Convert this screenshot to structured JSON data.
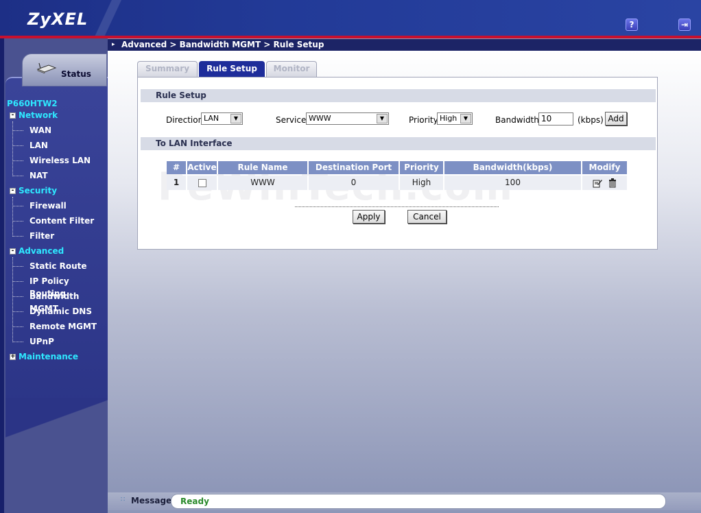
{
  "header": {
    "brand": "ZyXEL",
    "help_icon": "question-icon",
    "logout_icon": "logout-icon",
    "accent_red": "#c8102e",
    "brand_blue": "#1d2f86"
  },
  "breadcrumb": "Advanced > Bandwidth MGMT > Rule Setup",
  "sidebar": {
    "status_tab": "Status",
    "device_name": "P660HTW2",
    "sections": [
      {
        "label": "Network",
        "expanded": true,
        "items": [
          "WAN",
          "LAN",
          "Wireless LAN",
          "NAT"
        ]
      },
      {
        "label": "Security",
        "expanded": true,
        "items": [
          "Firewall",
          "Content Filter",
          "Filter"
        ]
      },
      {
        "label": "Advanced",
        "expanded": true,
        "items": [
          "Static Route",
          "IP Policy Routing",
          "Bandwidth MGMT",
          "Dynamic DNS",
          "Remote MGMT",
          "UPnP"
        ]
      },
      {
        "label": "Maintenance",
        "expanded": false,
        "items": []
      }
    ]
  },
  "tabs": {
    "summary": "Summary",
    "rule_setup": "Rule Setup",
    "monitor": "Monitor",
    "active": "Rule Setup"
  },
  "rule_setup": {
    "heading": "Rule Setup",
    "direction_label": "Direction",
    "direction_value": "LAN",
    "service_label": "Service",
    "service_value": "WWW",
    "priority_label": "Priority",
    "priority_value": "High",
    "bandwidth_label": "Bandwidth",
    "bandwidth_value": "10",
    "bandwidth_unit": "(kbps)",
    "add_label": "Add"
  },
  "lan_interface": {
    "heading": "To LAN Interface",
    "columns": [
      "#",
      "Active",
      "Rule Name",
      "Destination Port",
      "Priority",
      "Bandwidth(kbps)",
      "Modify"
    ],
    "rows": [
      {
        "num": "1",
        "active": false,
        "rule_name": "WWW",
        "destination_port": "0",
        "priority": "High",
        "bandwidth": "100"
      }
    ]
  },
  "actions": {
    "apply": "Apply",
    "cancel": "Cancel"
  },
  "status": {
    "message_label": "Message",
    "message": "Ready"
  }
}
